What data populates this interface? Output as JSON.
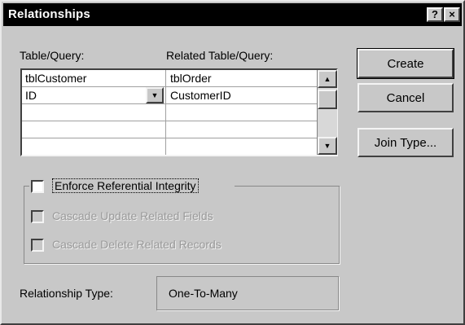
{
  "window": {
    "title": "Relationships",
    "help_label": "?",
    "close_label": "×"
  },
  "grid": {
    "left_header": "Table/Query:",
    "right_header": "Related Table/Query:",
    "left_table": "tblCustomer",
    "right_table": "tblOrder",
    "rows": [
      {
        "left": "ID",
        "right": "CustomerID"
      }
    ]
  },
  "options": {
    "enforce_label": "Enforce Referential Integrity",
    "cascade_update_label": "Cascade Update Related Fields",
    "cascade_delete_label": "Cascade Delete Related Records"
  },
  "relationship_type": {
    "label": "Relationship Type:",
    "value": "One-To-Many"
  },
  "buttons": {
    "create": "Create",
    "cancel": "Cancel",
    "join_type": "Join Type..."
  }
}
